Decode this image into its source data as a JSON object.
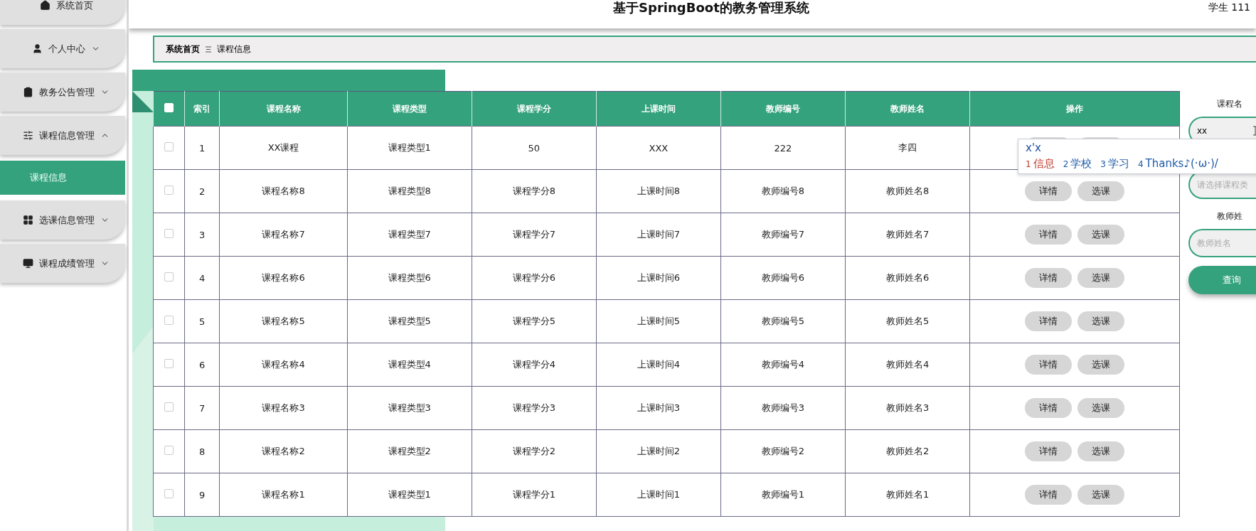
{
  "sidebar": {
    "items": [
      {
        "label": "系统首页",
        "kind": "link"
      },
      {
        "label": "个人中心",
        "kind": "menu",
        "expanded": false
      },
      {
        "label": "教务公告管理",
        "kind": "menu",
        "expanded": false
      },
      {
        "label": "课程信息管理",
        "kind": "menu",
        "expanded": true,
        "children": [
          {
            "label": "课程信息",
            "selected": true
          }
        ]
      },
      {
        "label": "选课信息管理",
        "kind": "menu",
        "expanded": false
      },
      {
        "label": "课程成绩管理",
        "kind": "menu",
        "expanded": false
      }
    ]
  },
  "header": {
    "title": "基于SpringBoot的教务管理系统",
    "user": "学生 111"
  },
  "breadcrumb": {
    "home": "系统首页",
    "current": "课程信息"
  },
  "table": {
    "all_checked": false,
    "columns": [
      "索引",
      "课程名称",
      "课程类型",
      "课程学分",
      "上课时间",
      "教师编号",
      "教师姓名",
      "操作"
    ],
    "rows": [
      {
        "checked": false,
        "cells": [
          "1",
          "XX课程",
          "课程类型1",
          "50",
          "XXX",
          "222",
          "李四"
        ]
      },
      {
        "checked": false,
        "cells": [
          "2",
          "课程名称8",
          "课程类型8",
          "课程学分8",
          "上课时间8",
          "教师编号8",
          "教师姓名8"
        ],
        "actions": [
          "详情",
          "选课"
        ]
      },
      {
        "checked": false,
        "cells": [
          "3",
          "课程名称7",
          "课程类型7",
          "课程学分7",
          "上课时间7",
          "教师编号7",
          "教师姓名7"
        ],
        "actions": [
          "详情",
          "选课"
        ]
      },
      {
        "checked": false,
        "cells": [
          "4",
          "课程名称6",
          "课程类型6",
          "课程学分6",
          "上课时间6",
          "教师编号6",
          "教师姓名6"
        ],
        "actions": [
          "详情",
          "选课"
        ]
      },
      {
        "checked": false,
        "cells": [
          "5",
          "课程名称5",
          "课程类型5",
          "课程学分5",
          "上课时间5",
          "教师编号5",
          "教师姓名5"
        ],
        "actions": [
          "详情",
          "选课"
        ]
      },
      {
        "checked": false,
        "cells": [
          "6",
          "课程名称4",
          "课程类型4",
          "课程学分4",
          "上课时间4",
          "教师编号4",
          "教师姓名4"
        ],
        "actions": [
          "详情",
          "选课"
        ]
      },
      {
        "checked": false,
        "cells": [
          "7",
          "课程名称3",
          "课程类型3",
          "课程学分3",
          "上课时间3",
          "教师编号3",
          "教师姓名3"
        ],
        "actions": [
          "详情",
          "选课"
        ]
      },
      {
        "checked": false,
        "cells": [
          "8",
          "课程名称2",
          "课程类型2",
          "课程学分2",
          "上课时间2",
          "教师编号2",
          "教师姓名2"
        ],
        "actions": [
          "详情",
          "选课"
        ]
      },
      {
        "checked": false,
        "cells": [
          "9",
          "课程名称1",
          "课程类型1",
          "课程学分1",
          "上课时间1",
          "教师编号1",
          "教师姓名1"
        ],
        "actions": [
          "详情",
          "选课"
        ]
      }
    ]
  },
  "search": {
    "fields": [
      {
        "label": "课程名",
        "value": "xx"
      },
      {
        "placeholder": "请选择课程类"
      },
      {
        "label": "教师姓",
        "placeholder": "教师姓名"
      }
    ],
    "button": "查询"
  },
  "ime": {
    "input": "x'x",
    "candidates": [
      {
        "number": "1",
        "text": "信息",
        "selected": true
      },
      {
        "number": "2",
        "text": "学校",
        "selected": false
      },
      {
        "number": "3",
        "text": "学习",
        "selected": false
      },
      {
        "number": "4",
        "text": "Thanks♪(·ω·)/",
        "selected": false
      }
    ]
  }
}
